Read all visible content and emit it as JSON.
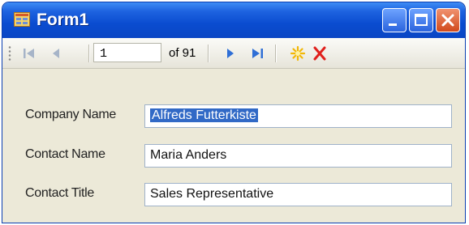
{
  "window": {
    "title": "Form1"
  },
  "toolbar": {
    "position_value": "1",
    "count_label": "of 91"
  },
  "fields": {
    "company_name": {
      "label": "Company Name",
      "value": "Alfreds Futterkiste"
    },
    "contact_name": {
      "label": "Contact Name",
      "value": "Maria Anders"
    },
    "contact_title": {
      "label": "Contact Title",
      "value": "Sales Representative"
    }
  },
  "colors": {
    "title_bar": "#0a4cd0",
    "window_bg": "#ece9d8",
    "selection": "#3169c6",
    "delete": "#e0201c"
  },
  "icons": {
    "move_first": "move-first-icon",
    "move_previous": "move-previous-icon",
    "move_next": "move-next-icon",
    "move_last": "move-last-icon",
    "add_new": "add-new-icon",
    "delete": "delete-icon"
  }
}
